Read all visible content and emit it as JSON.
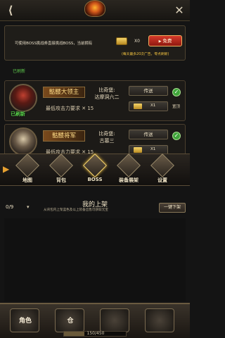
{
  "topbar": {
    "emblem_icon": "flame-emblem-icon",
    "left_icon": "back-icon",
    "right_icon": "close-icon"
  },
  "notice": {
    "text": "可使用BOSS挑战券直接挑战BOSS，当前拥有",
    "ticket_count": "X0",
    "free_button": "免费",
    "free_note": "(每天最多20次广告，零点刷新)"
  },
  "peek_text": "已刷新",
  "bosses": [
    {
      "name": "骷髅大领主",
      "location_line1": "比奇堡:",
      "location_line2": "达摩洞六二",
      "requirement": "最低攻击力要求 ✕ 15",
      "teleport": "传送",
      "ticket_x": "X1",
      "refreshed": "已刷新",
      "pin": "置顶"
    },
    {
      "name": "骷髅将军",
      "location_line1": "比奇堡:",
      "location_line2": "古墓三",
      "requirement": "最低攻击力要求 ✕ 15",
      "teleport": "传送",
      "ticket_x": "X1",
      "refreshed": "",
      "pin": ""
    }
  ],
  "iconbar": {
    "items": [
      "地图",
      "背包",
      "BOSS",
      "装备展架",
      "设置"
    ],
    "active": "BOSS"
  },
  "shelf": {
    "title": "我的上架",
    "count": "0/9",
    "description": "从背包内上架蓝色及以上装备出售可获取元宝",
    "button": "一键下架"
  },
  "bottomnav": {
    "items": [
      "角色",
      "仓",
      "",
      ""
    ]
  },
  "exp": {
    "text": "150/450",
    "fraction": 0.333
  }
}
